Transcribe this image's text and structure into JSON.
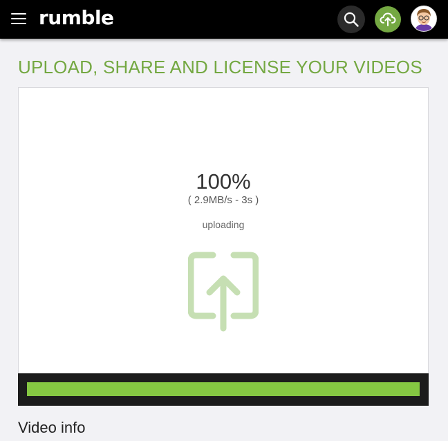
{
  "header": {
    "logo_text": "rumble",
    "menu_icon": "hamburger-menu-icon",
    "search_icon": "search-icon",
    "upload_icon": "cloud-upload-icon",
    "avatar_icon": "user-avatar",
    "accent_color": "#74a842",
    "background_color": "#000000"
  },
  "main": {
    "title": "UPLOAD, SHARE AND LICENSE YOUR VIDEOS",
    "upload": {
      "percent_text": "100%",
      "speed_text": "( 2.9MB/s - 3s )",
      "status_text": "uploading",
      "progress": 1.0,
      "progress_color": "#85c742",
      "art_icon": "upload-arrow-icon"
    },
    "section_heading": "Video info"
  }
}
